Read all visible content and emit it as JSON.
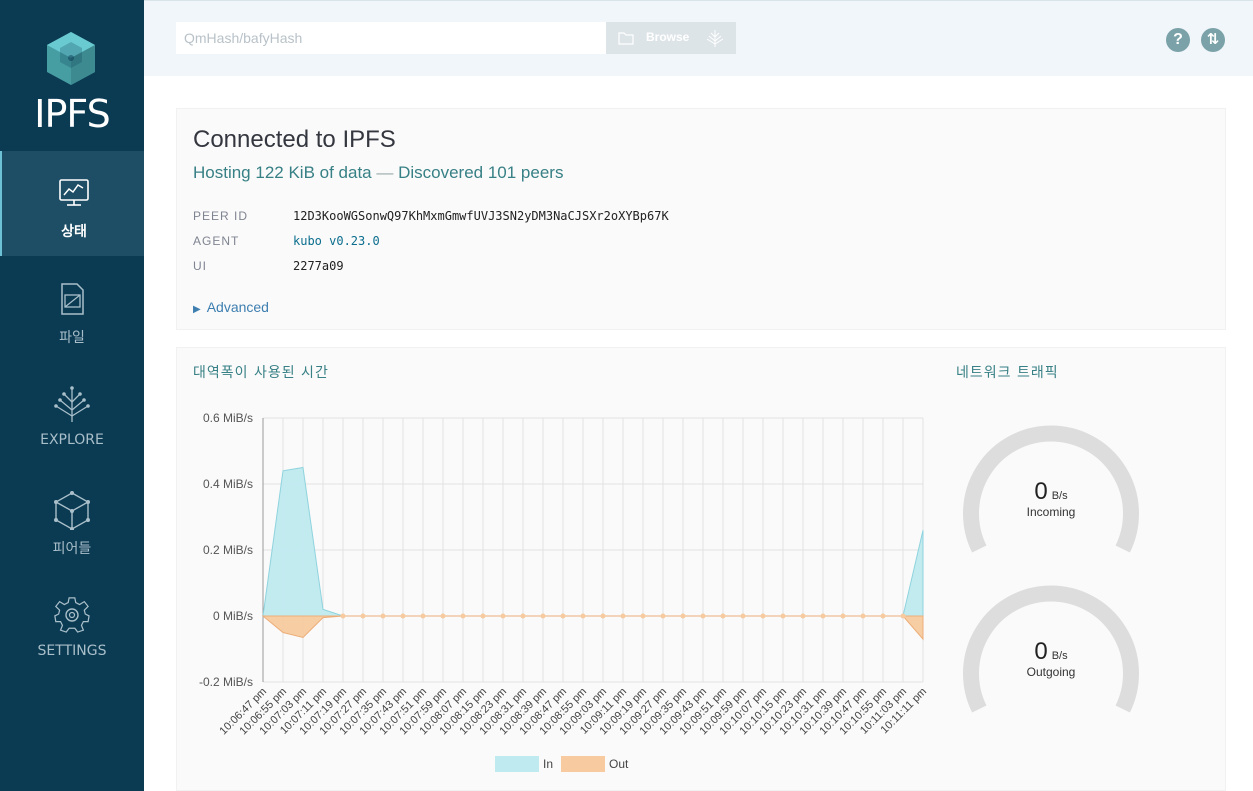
{
  "app": {
    "logo_text": "IPFS"
  },
  "sidebar": {
    "items": [
      {
        "label": "상태",
        "icon": "status-icon",
        "active": true
      },
      {
        "label": "파일",
        "icon": "files-icon",
        "active": false
      },
      {
        "label": "EXPLORE",
        "icon": "explore-icon",
        "active": false
      },
      {
        "label": "피어들",
        "icon": "peers-icon",
        "active": false
      },
      {
        "label": "SETTINGS",
        "icon": "settings-icon",
        "active": false
      }
    ]
  },
  "header": {
    "search_placeholder": "QmHash/bafyHash",
    "browse_label": "Browse",
    "help_icon_glyph": "?",
    "sync_icon_glyph": "⇅"
  },
  "status": {
    "title": "Connected to IPFS",
    "hosting": "Hosting 122 KiB of data",
    "separator": "—",
    "peers": "Discovered 101 peers",
    "rows": [
      {
        "key": "PEER ID",
        "value": "12D3KooWGSonwQ97KhMxmGmwfUVJ3SN2yDM3NaCJSXr2oXYBp67K"
      },
      {
        "key": "AGENT",
        "value": "kubo v0.23.0"
      },
      {
        "key": "UI",
        "value": "2277a09"
      }
    ],
    "advanced_label": "Advanced"
  },
  "bandwidth": {
    "title": "대역폭이 사용된 시간"
  },
  "traffic": {
    "title": "네트워크 트래픽",
    "incoming": {
      "value": "0",
      "unit": "B/s",
      "label": "Incoming",
      "fraction": 0
    },
    "outgoing": {
      "value": "0",
      "unit": "B/s",
      "label": "Outgoing",
      "fraction": 0
    }
  },
  "colors": {
    "in": "#bfeaef",
    "in_stroke": "#8fd3dd",
    "out": "#f7ca9f",
    "out_stroke": "#ecae79",
    "sidebar": "#0b3a53",
    "accent": "#378085"
  },
  "chart_data": {
    "type": "area",
    "ylabel": "",
    "ylim": [
      -0.2,
      0.6
    ],
    "y_ticks": [
      "0.6 MiB/s",
      "0.4 MiB/s",
      "0.2 MiB/s",
      "0 MiB/s",
      "-0.2 MiB/s"
    ],
    "y_tick_values": [
      0.6,
      0.4,
      0.2,
      0,
      -0.2
    ],
    "x_ticks": [
      "10:06:47 pm",
      "10:06:55 pm",
      "10:07:03 pm",
      "10:07:11 pm",
      "10:07:19 pm",
      "10:07:27 pm",
      "10:07:35 pm",
      "10:07:43 pm",
      "10:07:51 pm",
      "10:07:59 pm",
      "10:08:07 pm",
      "10:08:15 pm",
      "10:08:23 pm",
      "10:08:31 pm",
      "10:08:39 pm",
      "10:08:47 pm",
      "10:08:55 pm",
      "10:09:03 pm",
      "10:09:11 pm",
      "10:09:19 pm",
      "10:09:27 pm",
      "10:09:35 pm",
      "10:09:43 pm",
      "10:09:51 pm",
      "10:09:59 pm",
      "10:10:07 pm",
      "10:10:15 pm",
      "10:10:23 pm",
      "10:10:31 pm",
      "10:10:39 pm",
      "10:10:47 pm",
      "10:10:55 pm",
      "10:11:03 pm",
      "10:11:11 pm"
    ],
    "series": [
      {
        "name": "In",
        "values": [
          0.0,
          0.44,
          0.45,
          0.02,
          0.0,
          0.0,
          0.0,
          0.0,
          0.0,
          0.0,
          0.0,
          0.0,
          0.0,
          0.0,
          0.0,
          0.0,
          0.0,
          0.0,
          0.0,
          0.0,
          0.0,
          0.0,
          0.0,
          0.0,
          0.0,
          0.0,
          0.0,
          0.0,
          0.0,
          0.0,
          0.0,
          0.0,
          0.0,
          0.26
        ]
      },
      {
        "name": "Out",
        "values": [
          0.0,
          -0.05,
          -0.065,
          -0.005,
          0.0,
          0.0,
          0.0,
          0.0,
          0.0,
          0.0,
          0.0,
          0.0,
          0.0,
          0.0,
          0.0,
          0.0,
          0.0,
          0.0,
          0.0,
          0.0,
          0.0,
          0.0,
          0.0,
          0.0,
          0.0,
          0.0,
          0.0,
          0.0,
          0.0,
          0.0,
          0.0,
          0.0,
          0.0,
          -0.07
        ]
      }
    ],
    "legend": "bottom"
  }
}
